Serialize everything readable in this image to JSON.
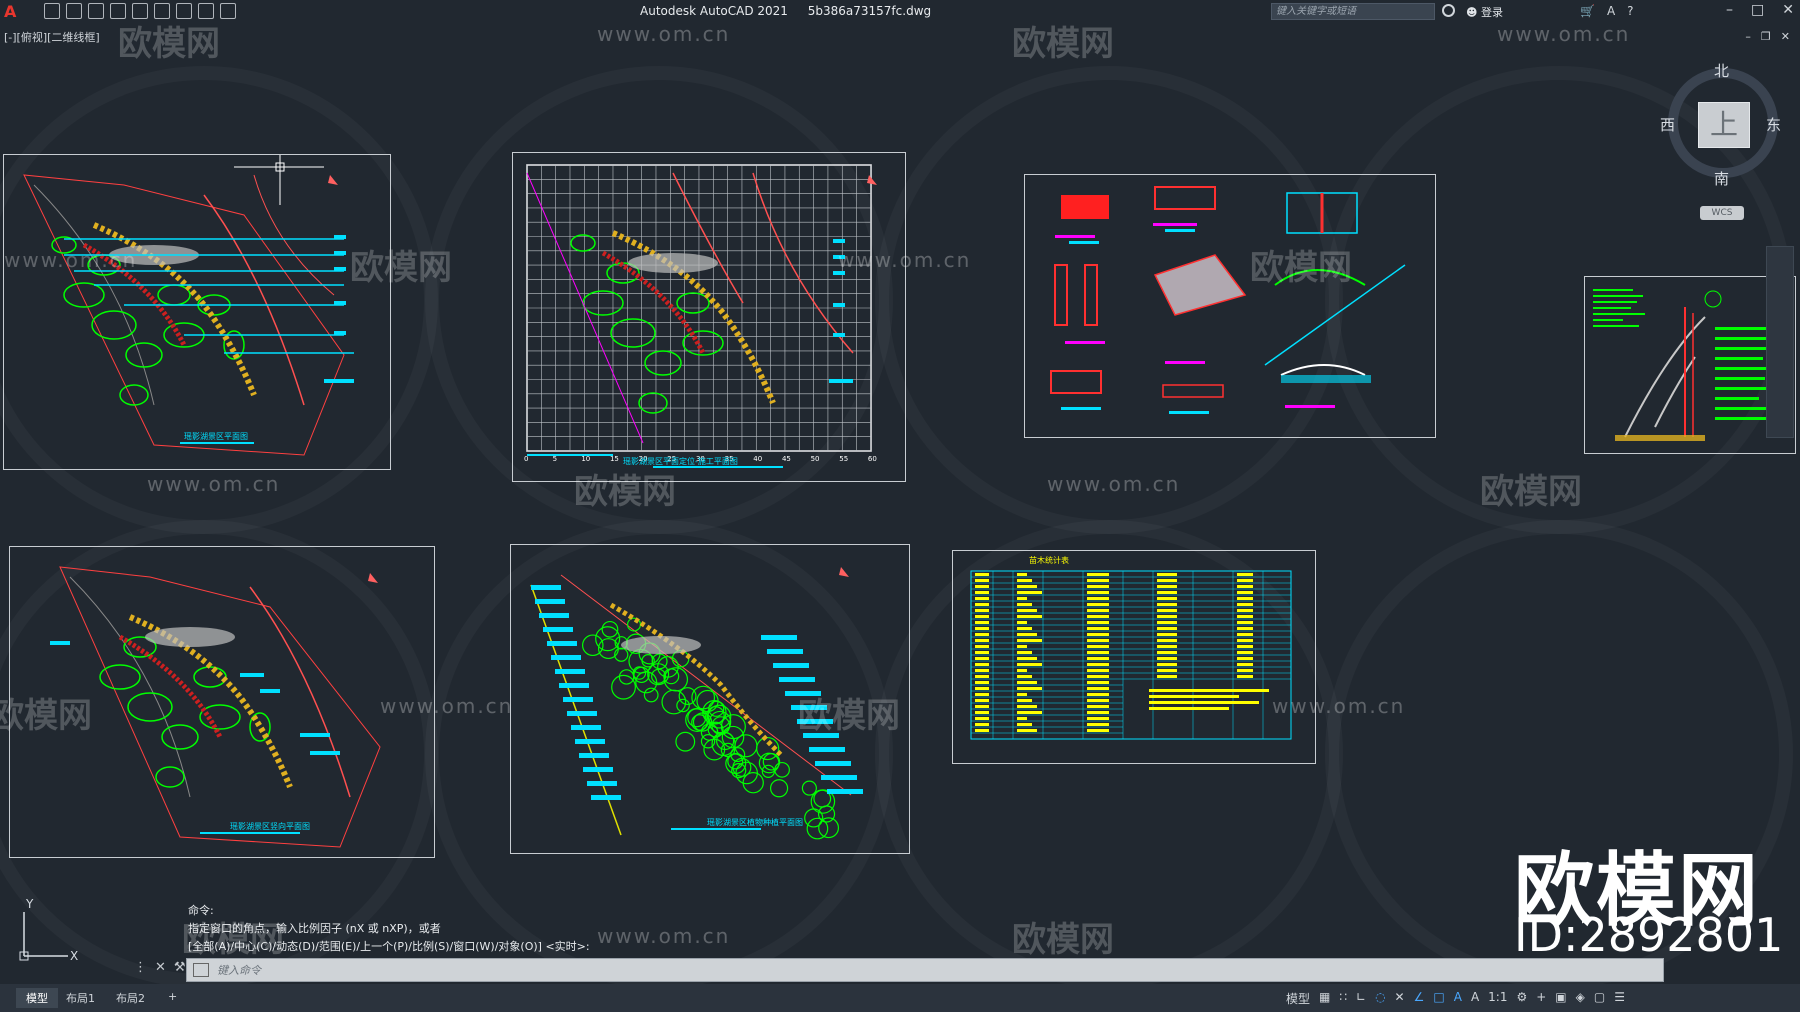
{
  "app": {
    "title": "Autodesk AutoCAD 2021",
    "file": "5b386a73157fc.dwg",
    "view_label": "[-][俯视][二维线框]"
  },
  "header": {
    "search_placeholder": "键入关键字或短语",
    "login_label": "登录"
  },
  "watermark": {
    "brand": "欧模网",
    "url": "www.om.cn"
  },
  "viewcube": {
    "north": "北",
    "south": "南",
    "east": "东",
    "west": "西",
    "top_face": "上",
    "wcs": "WCS"
  },
  "sheets": {
    "plan1_title": "瑶影湖景区平面图",
    "plan2_title": "瑶影湖景区平面定位-施工平面图",
    "plan3_title": "瑶影湖景区竖向平面图",
    "plan4_title": "瑶影湖景区植物种植平面图",
    "table_title": "苗木统计表",
    "grid_ticks": [
      "0",
      "5",
      "10",
      "15",
      "20",
      "25",
      "30",
      "35",
      "40",
      "45",
      "50",
      "55",
      "60"
    ]
  },
  "command": {
    "history": [
      "命令:",
      "指定窗口的角点，输入比例因子 (nX 或 nXP)，或者",
      "[全部(A)/中心(C)/动态(D)/范围(E)/上一个(P)/比例(S)/窗口(W)/对象(O)] <实时>:"
    ],
    "placeholder": "键入命令"
  },
  "layout_tabs": [
    "模型",
    "布局1",
    "布局2",
    "+"
  ],
  "status": {
    "model_label": "模型",
    "scale": "1:1"
  },
  "brand_overlay": {
    "name": "欧模网",
    "id": "ID:2892801"
  },
  "colors": {
    "background": "#212830",
    "cyan": "#00ffff",
    "green": "#00ff00",
    "yellow": "#ffff00",
    "red": "#ff3030",
    "magenta": "#ff00ff"
  }
}
